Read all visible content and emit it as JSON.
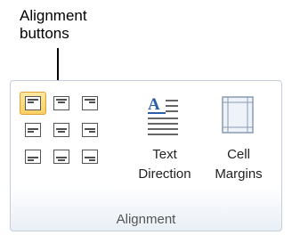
{
  "callout": {
    "line1": "Alignment",
    "line2": "buttons"
  },
  "group": {
    "label": "Alignment",
    "text_direction": {
      "line1": "Text",
      "line2": "Direction",
      "icon": "text-direction-icon"
    },
    "cell_margins": {
      "line1": "Cell",
      "line2": "Margins",
      "icon": "cell-margins-icon"
    }
  },
  "align_buttons": [
    {
      "name": "align-top-left",
      "selected": true
    },
    {
      "name": "align-top-center",
      "selected": false
    },
    {
      "name": "align-top-right",
      "selected": false
    },
    {
      "name": "align-center-left",
      "selected": false
    },
    {
      "name": "align-center",
      "selected": false
    },
    {
      "name": "align-center-right",
      "selected": false
    },
    {
      "name": "align-bottom-left",
      "selected": false
    },
    {
      "name": "align-bottom-center",
      "selected": false
    },
    {
      "name": "align-bottom-right",
      "selected": false
    }
  ],
  "colors": {
    "selected_fill": "#f9cf61",
    "selected_border": "#e3a334",
    "group_border": "#c5cfdc",
    "icon_blue": "#2b5fa8"
  }
}
